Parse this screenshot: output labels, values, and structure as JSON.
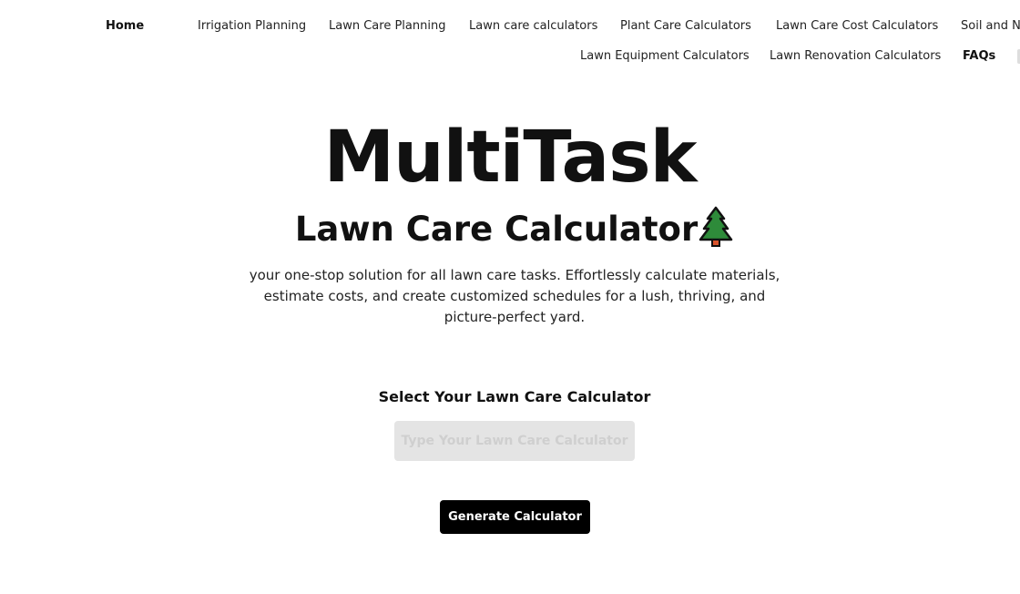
{
  "nav": {
    "row1": [
      "Home",
      "Irrigation Planning",
      "Lawn Care Planning",
      "Lawn care calculators",
      "Plant Care Calculators",
      "Lawn Care Cost Calculators",
      "Soil and Nu"
    ],
    "row2": [
      "Lawn Equipment Calculators",
      "Lawn Renovation Calculators",
      "FAQs"
    ]
  },
  "hero": {
    "title": "MultiTask",
    "subtitle": "Lawn Care Calculator",
    "subtitle_icon": "evergreen-tree-icon",
    "description": "your one-stop solution for all lawn care tasks. Effortlessly calculate materials, estimate costs, and create customized schedules for a lush, thriving, and picture-perfect yard."
  },
  "form": {
    "label": "Select Your Lawn Care Calculator",
    "input_placeholder": "Type Your Lawn Care Calculator",
    "input_value": "",
    "button": "Generate Calculator"
  },
  "colors": {
    "button_bg": "#000000",
    "input_bg": "#e4e4e4",
    "tree": "#2e8b3a"
  }
}
